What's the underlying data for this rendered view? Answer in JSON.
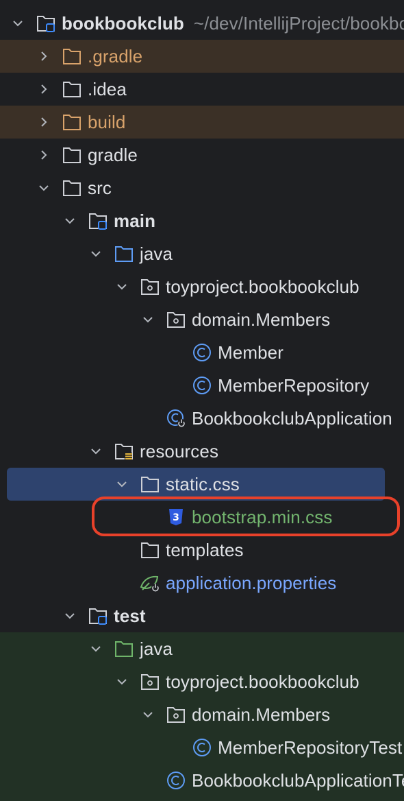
{
  "project_tree": {
    "root": {
      "name": "bookbookclub",
      "path": "~/dev/IntellijProject/bookbookclub"
    },
    "nodes": [
      {
        "label": ".gradle",
        "icon": "folder-icon",
        "state": "collapsed",
        "style": "excluded"
      },
      {
        "label": ".idea",
        "icon": "folder-icon",
        "state": "collapsed",
        "style": "normal"
      },
      {
        "label": "build",
        "icon": "folder-icon",
        "state": "collapsed",
        "style": "excluded"
      },
      {
        "label": "gradle",
        "icon": "folder-icon",
        "state": "collapsed",
        "style": "normal"
      },
      {
        "label": "src",
        "icon": "folder-icon",
        "state": "expanded",
        "style": "normal"
      },
      {
        "label": "main",
        "icon": "module-folder-icon",
        "state": "expanded",
        "style": "bold"
      },
      {
        "label": "java",
        "icon": "source-folder-icon",
        "state": "expanded",
        "style": "normal"
      },
      {
        "label": "toyproject.bookbookclub",
        "icon": "package-icon",
        "state": "expanded",
        "style": "normal"
      },
      {
        "label": "domain.Members",
        "icon": "package-icon",
        "state": "expanded",
        "style": "normal"
      },
      {
        "label": "Member",
        "icon": "class-icon",
        "state": "leaf",
        "style": "normal"
      },
      {
        "label": "MemberRepository",
        "icon": "class-icon",
        "state": "leaf",
        "style": "normal"
      },
      {
        "label": "BookbookclubApplication",
        "icon": "spring-boot-class-icon",
        "state": "leaf",
        "style": "normal"
      },
      {
        "label": "resources",
        "icon": "resources-folder-icon",
        "state": "expanded",
        "style": "normal"
      },
      {
        "label": "static.css",
        "icon": "folder-icon",
        "state": "expanded",
        "style": "selected"
      },
      {
        "label": "bootstrap.min.css",
        "icon": "css-file-icon",
        "state": "leaf",
        "style": "green"
      },
      {
        "label": "templates",
        "icon": "folder-icon",
        "state": "leaf",
        "style": "normal"
      },
      {
        "label": "application.properties",
        "icon": "spring-properties-icon",
        "state": "leaf",
        "style": "blue"
      },
      {
        "label": "test",
        "icon": "module-folder-icon",
        "state": "expanded",
        "style": "bold"
      },
      {
        "label": "java",
        "icon": "test-source-folder-icon",
        "state": "expanded",
        "style": "normal"
      },
      {
        "label": "toyproject.bookbookclub",
        "icon": "package-icon",
        "state": "expanded",
        "style": "normal"
      },
      {
        "label": "domain.Members",
        "icon": "package-icon",
        "state": "expanded",
        "style": "normal"
      },
      {
        "label": "MemberRepositoryTest",
        "icon": "class-icon",
        "state": "leaf",
        "style": "normal"
      },
      {
        "label": "BookbookclubApplicationTests",
        "icon": "class-icon",
        "state": "leaf",
        "style": "normal"
      }
    ]
  },
  "colors": {
    "background": "#1e1f22",
    "excluded_row": "#3b3026",
    "test_row": "#223125",
    "selection": "#2e436e",
    "highlight_annotation": "#e8412a",
    "text": "#dfe1e5",
    "excluded_text": "#d9a36b",
    "css_file_text": "#73b56e",
    "properties_text": "#7aa7ff"
  }
}
